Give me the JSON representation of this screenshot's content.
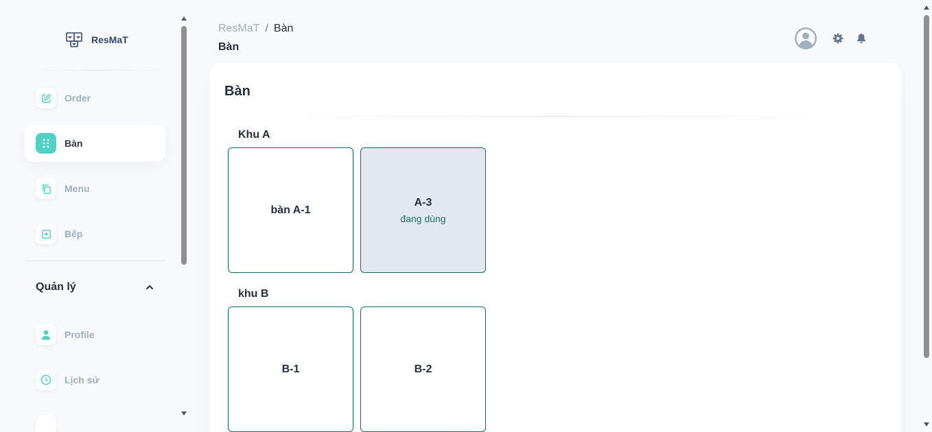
{
  "brand": {
    "name": "ResMaT"
  },
  "sidebar": {
    "items": [
      {
        "label": "Order",
        "icon": "edit-icon"
      },
      {
        "label": "Bàn",
        "icon": "grid-dots-icon",
        "active": true
      },
      {
        "label": "Menu",
        "icon": "copy-icon"
      },
      {
        "label": "Bếp",
        "icon": "plus-square-icon"
      }
    ],
    "section": {
      "title": "Quản lý",
      "expanded": true
    },
    "section_items": [
      {
        "label": "Profile",
        "icon": "user-icon"
      },
      {
        "label": "Lịch sử",
        "icon": "clock-icon"
      }
    ]
  },
  "header": {
    "breadcrumb": {
      "root": "ResMaT",
      "separator": "/",
      "current": "Bàn"
    },
    "page_title": "Bàn"
  },
  "main": {
    "title": "Bàn",
    "areas": [
      {
        "name": "Khu A",
        "tables": [
          {
            "name": "bàn A-1",
            "status": ""
          },
          {
            "name": "A-3",
            "status": "đang dùng"
          }
        ]
      },
      {
        "name": "khu B",
        "tables": [
          {
            "name": "B-1",
            "status": ""
          },
          {
            "name": "B-2",
            "status": ""
          }
        ]
      }
    ]
  },
  "colors": {
    "accent": "#4fd1c5",
    "table_border": "#0d6e68",
    "busy_bg": "#e2e8f0",
    "status_text": "#1f6f5a"
  }
}
